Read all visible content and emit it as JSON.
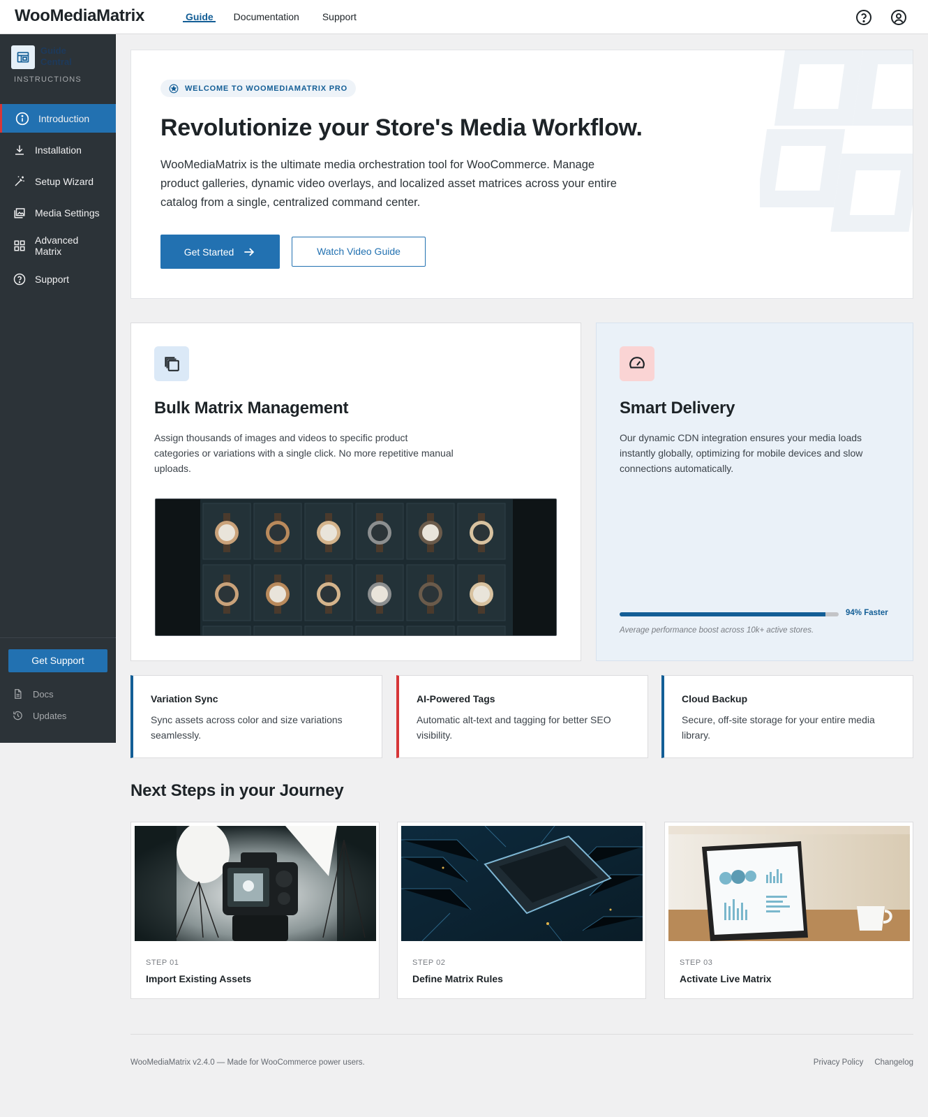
{
  "app": {
    "brand": "WooMediaMatrix"
  },
  "topnav": {
    "items": [
      "Guide",
      "Documentation",
      "Support"
    ]
  },
  "sidebar": {
    "brand": "Guide Central",
    "subtitle": "INSTRUCTIONS",
    "items": [
      {
        "label": "Introduction",
        "icon": "info-icon"
      },
      {
        "label": "Installation",
        "icon": "download-icon"
      },
      {
        "label": "Setup Wizard",
        "icon": "magic-wand-icon"
      },
      {
        "label": "Media Settings",
        "icon": "media-library-icon"
      },
      {
        "label": "Advanced Matrix",
        "icon": "grid-icon"
      },
      {
        "label": "Support",
        "icon": "help-circle-icon"
      }
    ],
    "support_button": "Get Support",
    "links": [
      {
        "label": "Docs",
        "icon": "document-icon"
      },
      {
        "label": "Updates",
        "icon": "history-icon"
      }
    ]
  },
  "hero": {
    "badge": "WELCOME TO WOOMEDIAMATRIX PRO",
    "title": "Revolutionize your Store's Media Workflow.",
    "description": "WooMediaMatrix is the ultimate media orchestration tool for WooCommerce. Manage product galleries, dynamic video overlays, and localized asset matrices across your entire catalog from a single, centralized command center.",
    "primary_button": "Get Started",
    "secondary_button": "Watch Video Guide"
  },
  "features": {
    "bulk": {
      "title": "Bulk Matrix Management",
      "description": "Assign thousands of images and videos to specific product categories or variations with a single click. No more repetitive manual uploads."
    },
    "smart": {
      "title": "Smart Delivery",
      "description": "Our dynamic CDN integration ensures your media loads instantly globally, optimizing for mobile devices and slow connections automatically.",
      "progress_value": 0.94,
      "progress_label": "94% Faster",
      "caption": "Average performance boost across 10k+ active stores."
    }
  },
  "mini_cards": [
    {
      "title": "Variation Sync",
      "description": "Sync assets across color and size variations seamlessly.",
      "accent": "#135e96"
    },
    {
      "title": "AI-Powered Tags",
      "description": "Automatic alt-text and tagging for better SEO visibility.",
      "accent": "#d63638"
    },
    {
      "title": "Cloud Backup",
      "description": "Secure, off-site storage for your entire media library.",
      "accent": "#135e96"
    }
  ],
  "next_steps": {
    "title": "Next Steps in your Journey",
    "steps": [
      {
        "label": "STEP 01",
        "title": "Import Existing Assets"
      },
      {
        "label": "STEP 02",
        "title": "Define Matrix Rules"
      },
      {
        "label": "STEP 03",
        "title": "Activate Live Matrix"
      }
    ]
  },
  "footer": {
    "text": "WooMediaMatrix v2.4.0 — Made for WooCommerce power users.",
    "links": [
      "Privacy Policy",
      "Changelog"
    ]
  },
  "colors": {
    "primary": "#2271b1",
    "dark": "#135e96",
    "sidebar": "#2c3338",
    "danger": "#d63638"
  }
}
